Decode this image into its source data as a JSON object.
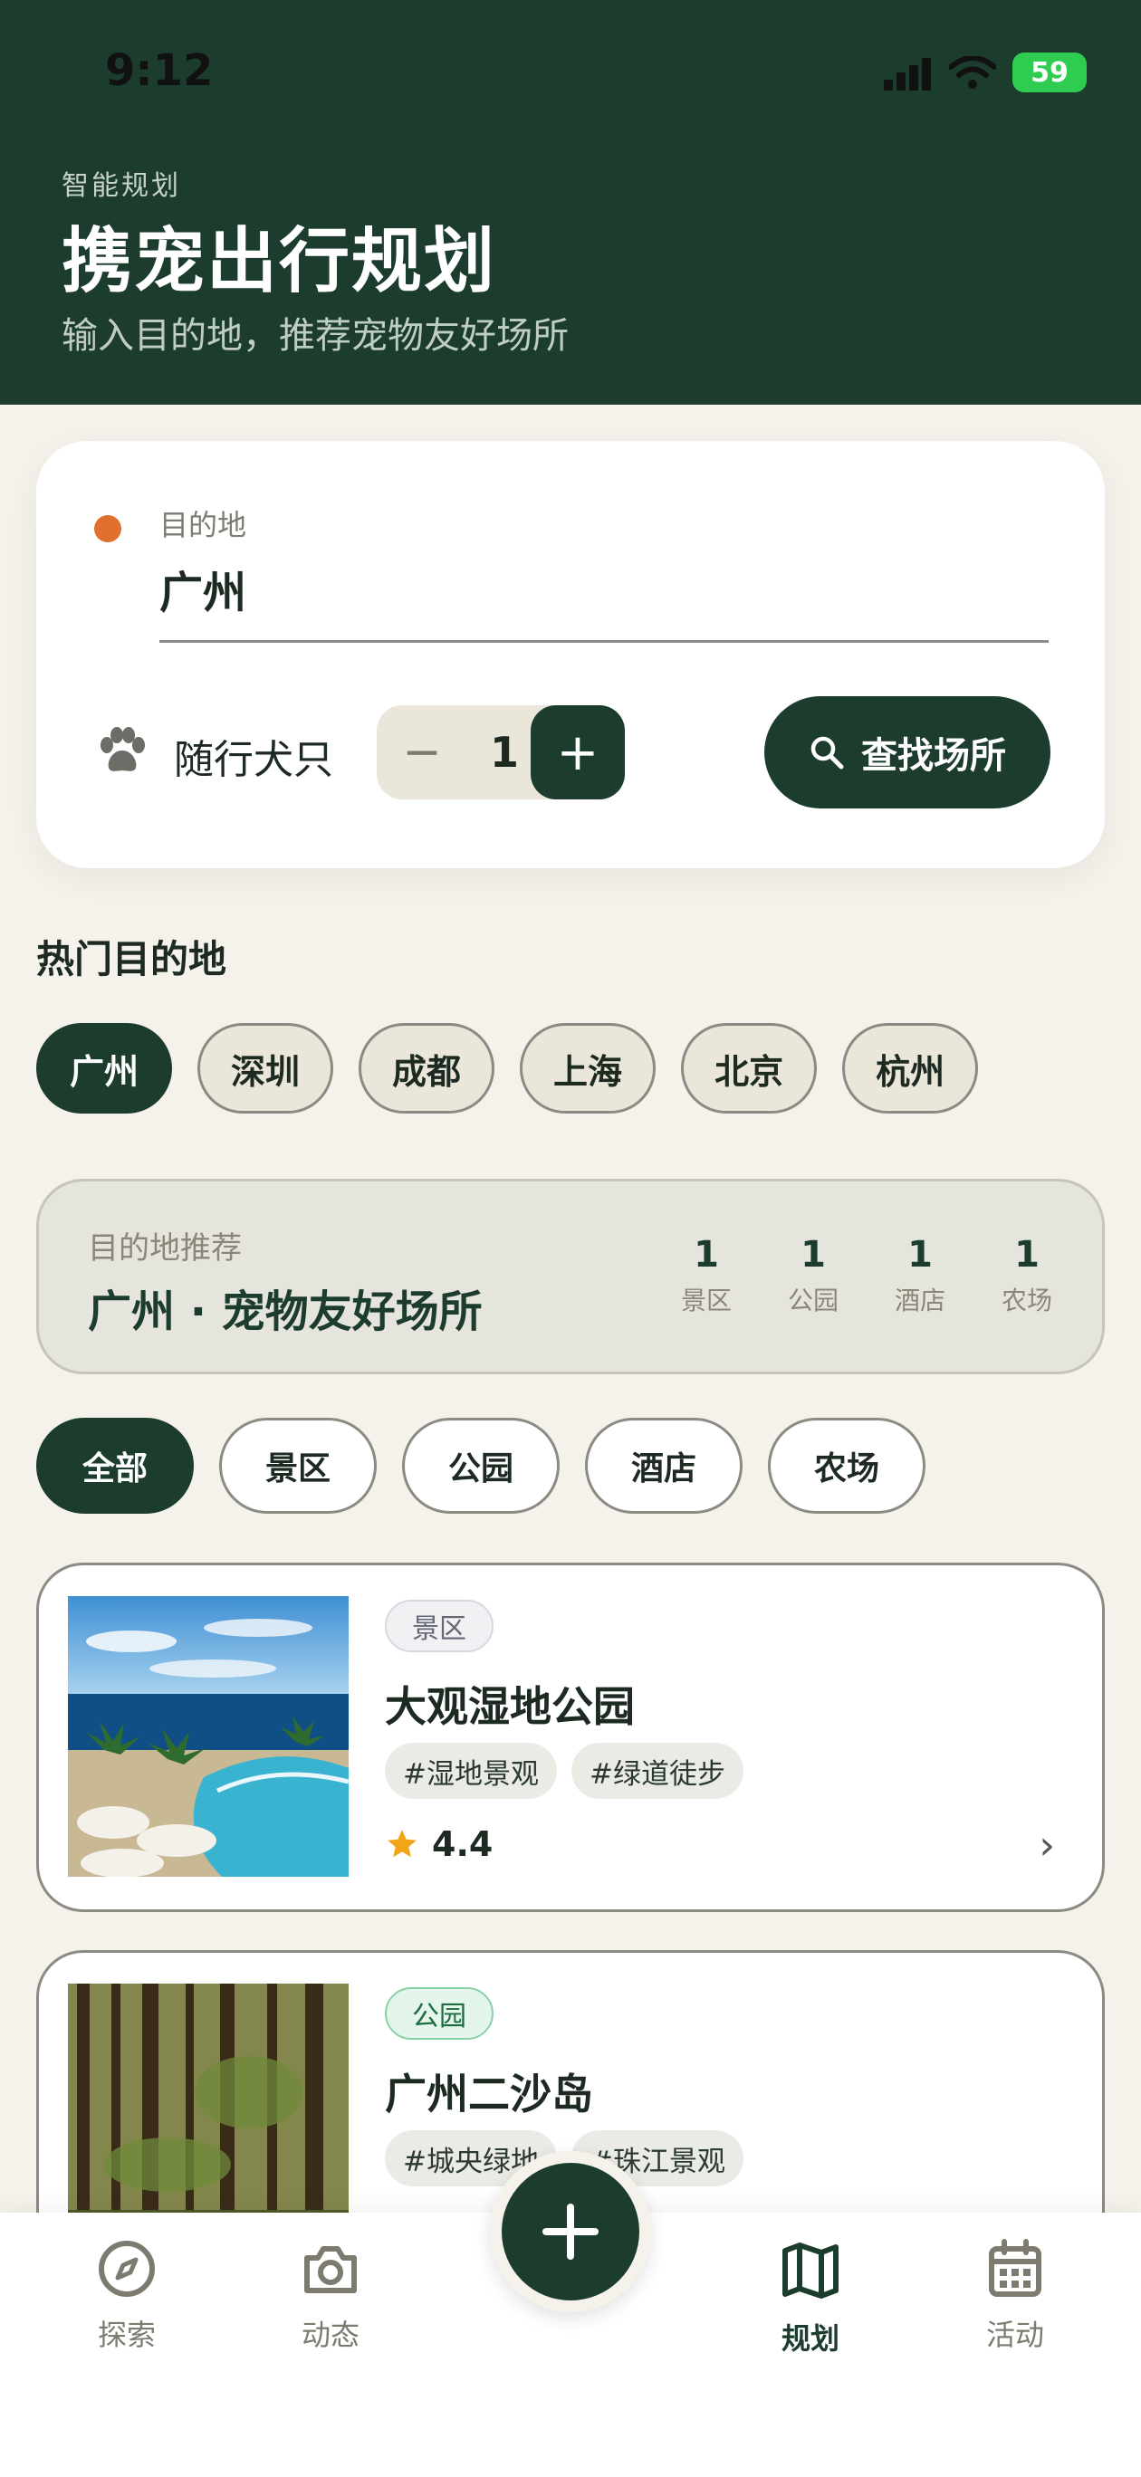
{
  "status": {
    "time": "9:12",
    "battery": "59"
  },
  "header": {
    "eyebrow": "智能规划",
    "title": "携宠出行规划",
    "description": "输入目的地，推荐宠物友好场所"
  },
  "search": {
    "dest_label": "目的地",
    "dest_value": "广州",
    "dog_label": "随行犬只",
    "dog_count": "1",
    "minus": "−",
    "plus": "+",
    "find_label": "查找场所"
  },
  "hot": {
    "title": "热门目的地",
    "cities": [
      {
        "label": "广州",
        "active": true
      },
      {
        "label": "深圳",
        "active": false
      },
      {
        "label": "成都",
        "active": false
      },
      {
        "label": "上海",
        "active": false
      },
      {
        "label": "北京",
        "active": false
      },
      {
        "label": "杭州",
        "active": false
      }
    ]
  },
  "recommend": {
    "label": "目的地推荐",
    "title": "广州 · 宠物友好场所",
    "stats": [
      {
        "num": "1",
        "label": "景区"
      },
      {
        "num": "1",
        "label": "公园"
      },
      {
        "num": "1",
        "label": "酒店"
      },
      {
        "num": "1",
        "label": "农场"
      }
    ]
  },
  "filters": [
    {
      "label": "全部",
      "active": true
    },
    {
      "label": "景区",
      "active": false
    },
    {
      "label": "公园",
      "active": false
    },
    {
      "label": "酒店",
      "active": false
    },
    {
      "label": "农场",
      "active": false
    }
  ],
  "places": [
    {
      "badge": "景区",
      "name": "大观湿地公园",
      "tags": [
        "#湿地景观",
        "#绿道徒步"
      ],
      "rating": "4.4"
    },
    {
      "badge": "公园",
      "name": "广州二沙岛",
      "tags": [
        "#城央绿地",
        "#珠江景观"
      ]
    }
  ],
  "tabs": [
    {
      "label": "探索",
      "icon": "compass-icon"
    },
    {
      "label": "动态",
      "icon": "camera-icon"
    },
    {
      "label": "规划",
      "icon": "map-icon",
      "active": true
    },
    {
      "label": "活动",
      "icon": "calendar-icon"
    }
  ],
  "colors": {
    "primary": "#1c3d2d",
    "accent": "#e0702e",
    "background": "#f5f2ec"
  }
}
